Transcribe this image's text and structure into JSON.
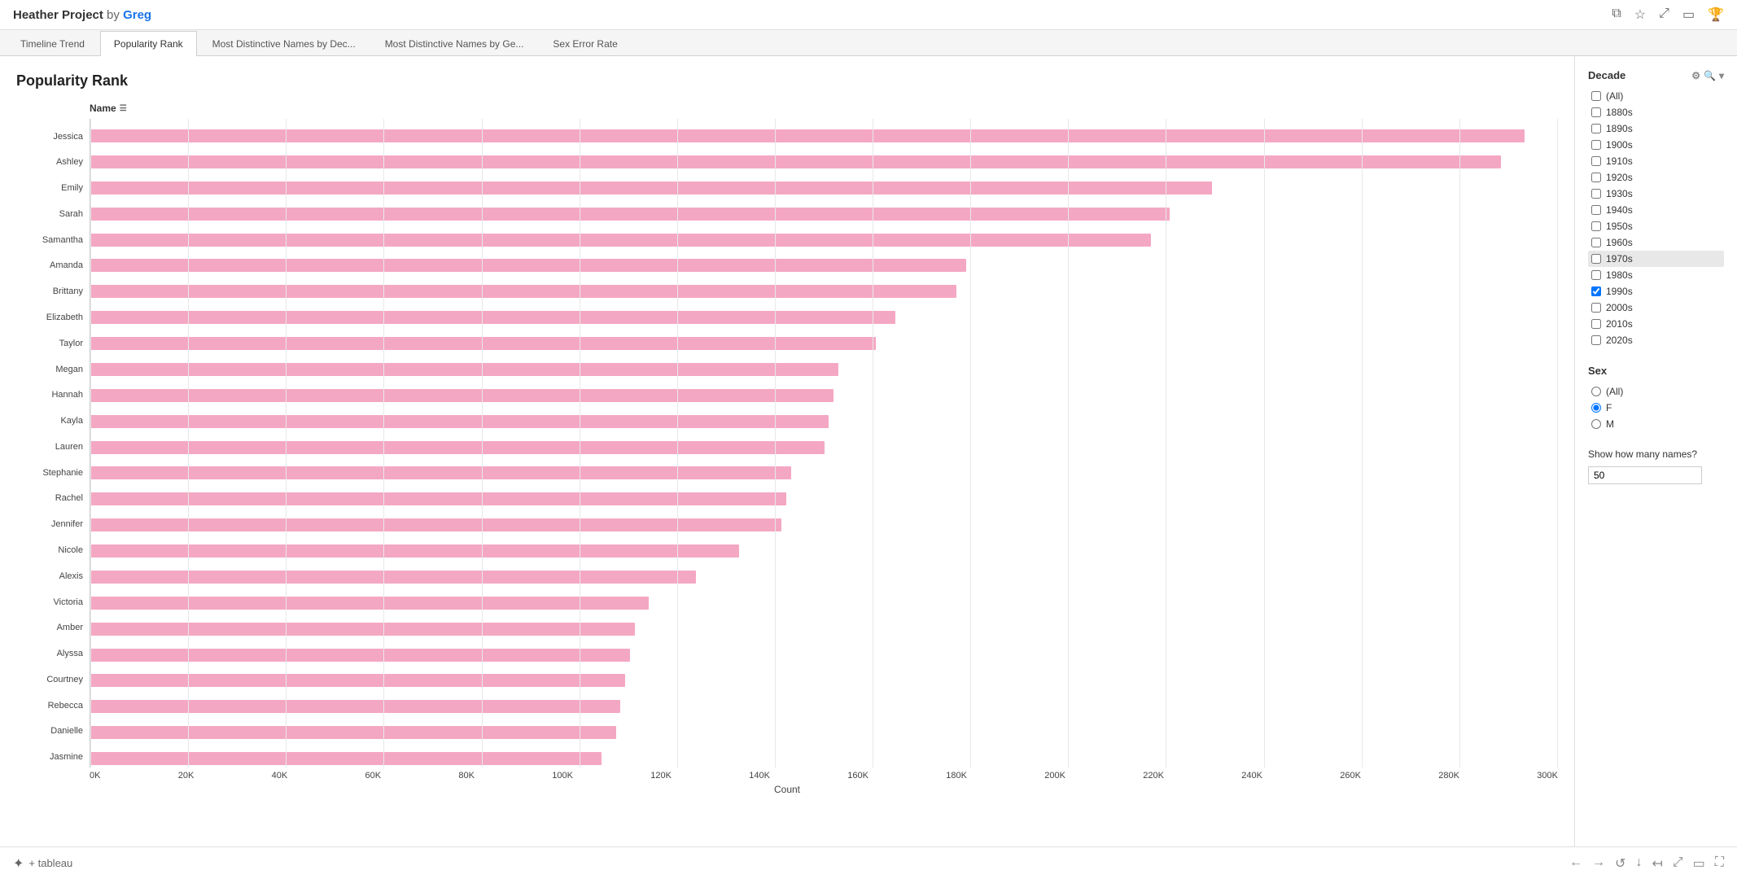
{
  "header": {
    "title": "Heather Project",
    "by_label": "by",
    "author": "Greg",
    "icons": [
      "copy-icon",
      "star-icon",
      "share-icon",
      "present-icon",
      "user-icon"
    ]
  },
  "tabs": [
    {
      "label": "Timeline Trend",
      "active": false
    },
    {
      "label": "Popularity Rank",
      "active": true
    },
    {
      "label": "Most Distinctive Names by Dec...",
      "active": false
    },
    {
      "label": "Most Distinctive Names by Ge...",
      "active": false
    },
    {
      "label": "Sex Error Rate",
      "active": false
    }
  ],
  "chart": {
    "title": "Popularity Rank",
    "y_axis_label": "Name",
    "x_axis_label": "Count",
    "x_labels": [
      "0K",
      "20K",
      "40K",
      "60K",
      "80K",
      "100K",
      "120K",
      "140K",
      "160K",
      "180K",
      "200K",
      "220K",
      "240K",
      "260K",
      "280K",
      "300K"
    ],
    "max_value": 310000,
    "names": [
      {
        "name": "Jessica",
        "value": 303000
      },
      {
        "name": "Ashley",
        "value": 298000
      },
      {
        "name": "Emily",
        "value": 237000
      },
      {
        "name": "Sarah",
        "value": 228000
      },
      {
        "name": "Samantha",
        "value": 224000
      },
      {
        "name": "Amanda",
        "value": 185000
      },
      {
        "name": "Brittany",
        "value": 183000
      },
      {
        "name": "Elizabeth",
        "value": 170000
      },
      {
        "name": "Taylor",
        "value": 166000
      },
      {
        "name": "Megan",
        "value": 158000
      },
      {
        "name": "Hannah",
        "value": 157000
      },
      {
        "name": "Kayla",
        "value": 156000
      },
      {
        "name": "Lauren",
        "value": 155000
      },
      {
        "name": "Stephanie",
        "value": 148000
      },
      {
        "name": "Rachel",
        "value": 147000
      },
      {
        "name": "Jennifer",
        "value": 146000
      },
      {
        "name": "Nicole",
        "value": 137000
      },
      {
        "name": "Alexis",
        "value": 128000
      },
      {
        "name": "Victoria",
        "value": 118000
      },
      {
        "name": "Amber",
        "value": 115000
      },
      {
        "name": "Alyssa",
        "value": 114000
      },
      {
        "name": "Courtney",
        "value": 113000
      },
      {
        "name": "Rebecca",
        "value": 112000
      },
      {
        "name": "Danielle",
        "value": 111000
      },
      {
        "name": "Jasmine",
        "value": 108000
      }
    ]
  },
  "sidebar": {
    "decade_title": "Decade",
    "decades": [
      {
        "label": "(All)",
        "checked": false
      },
      {
        "label": "1880s",
        "checked": false
      },
      {
        "label": "1890s",
        "checked": false
      },
      {
        "label": "1900s",
        "checked": false
      },
      {
        "label": "1910s",
        "checked": false
      },
      {
        "label": "1920s",
        "checked": false
      },
      {
        "label": "1930s",
        "checked": false
      },
      {
        "label": "1940s",
        "checked": false
      },
      {
        "label": "1950s",
        "checked": false
      },
      {
        "label": "1960s",
        "checked": false
      },
      {
        "label": "1970s",
        "checked": false,
        "highlighted": true
      },
      {
        "label": "1980s",
        "checked": false
      },
      {
        "label": "1990s",
        "checked": true
      },
      {
        "label": "2000s",
        "checked": false
      },
      {
        "label": "2010s",
        "checked": false
      },
      {
        "label": "2020s",
        "checked": false
      }
    ],
    "sex_title": "Sex",
    "sex_options": [
      {
        "label": "(All)",
        "value": "all",
        "checked": false
      },
      {
        "label": "F",
        "value": "f",
        "checked": true
      },
      {
        "label": "M",
        "value": "m",
        "checked": false
      }
    ],
    "show_names_label": "Show how many names?",
    "show_names_value": "50"
  },
  "footer": {
    "logo_text": "+ tableau",
    "nav_icons": [
      "back-icon",
      "forward-icon",
      "undo-icon",
      "down-icon",
      "left-icon",
      "share-footer-icon",
      "present-footer-icon",
      "fullscreen-icon"
    ]
  }
}
